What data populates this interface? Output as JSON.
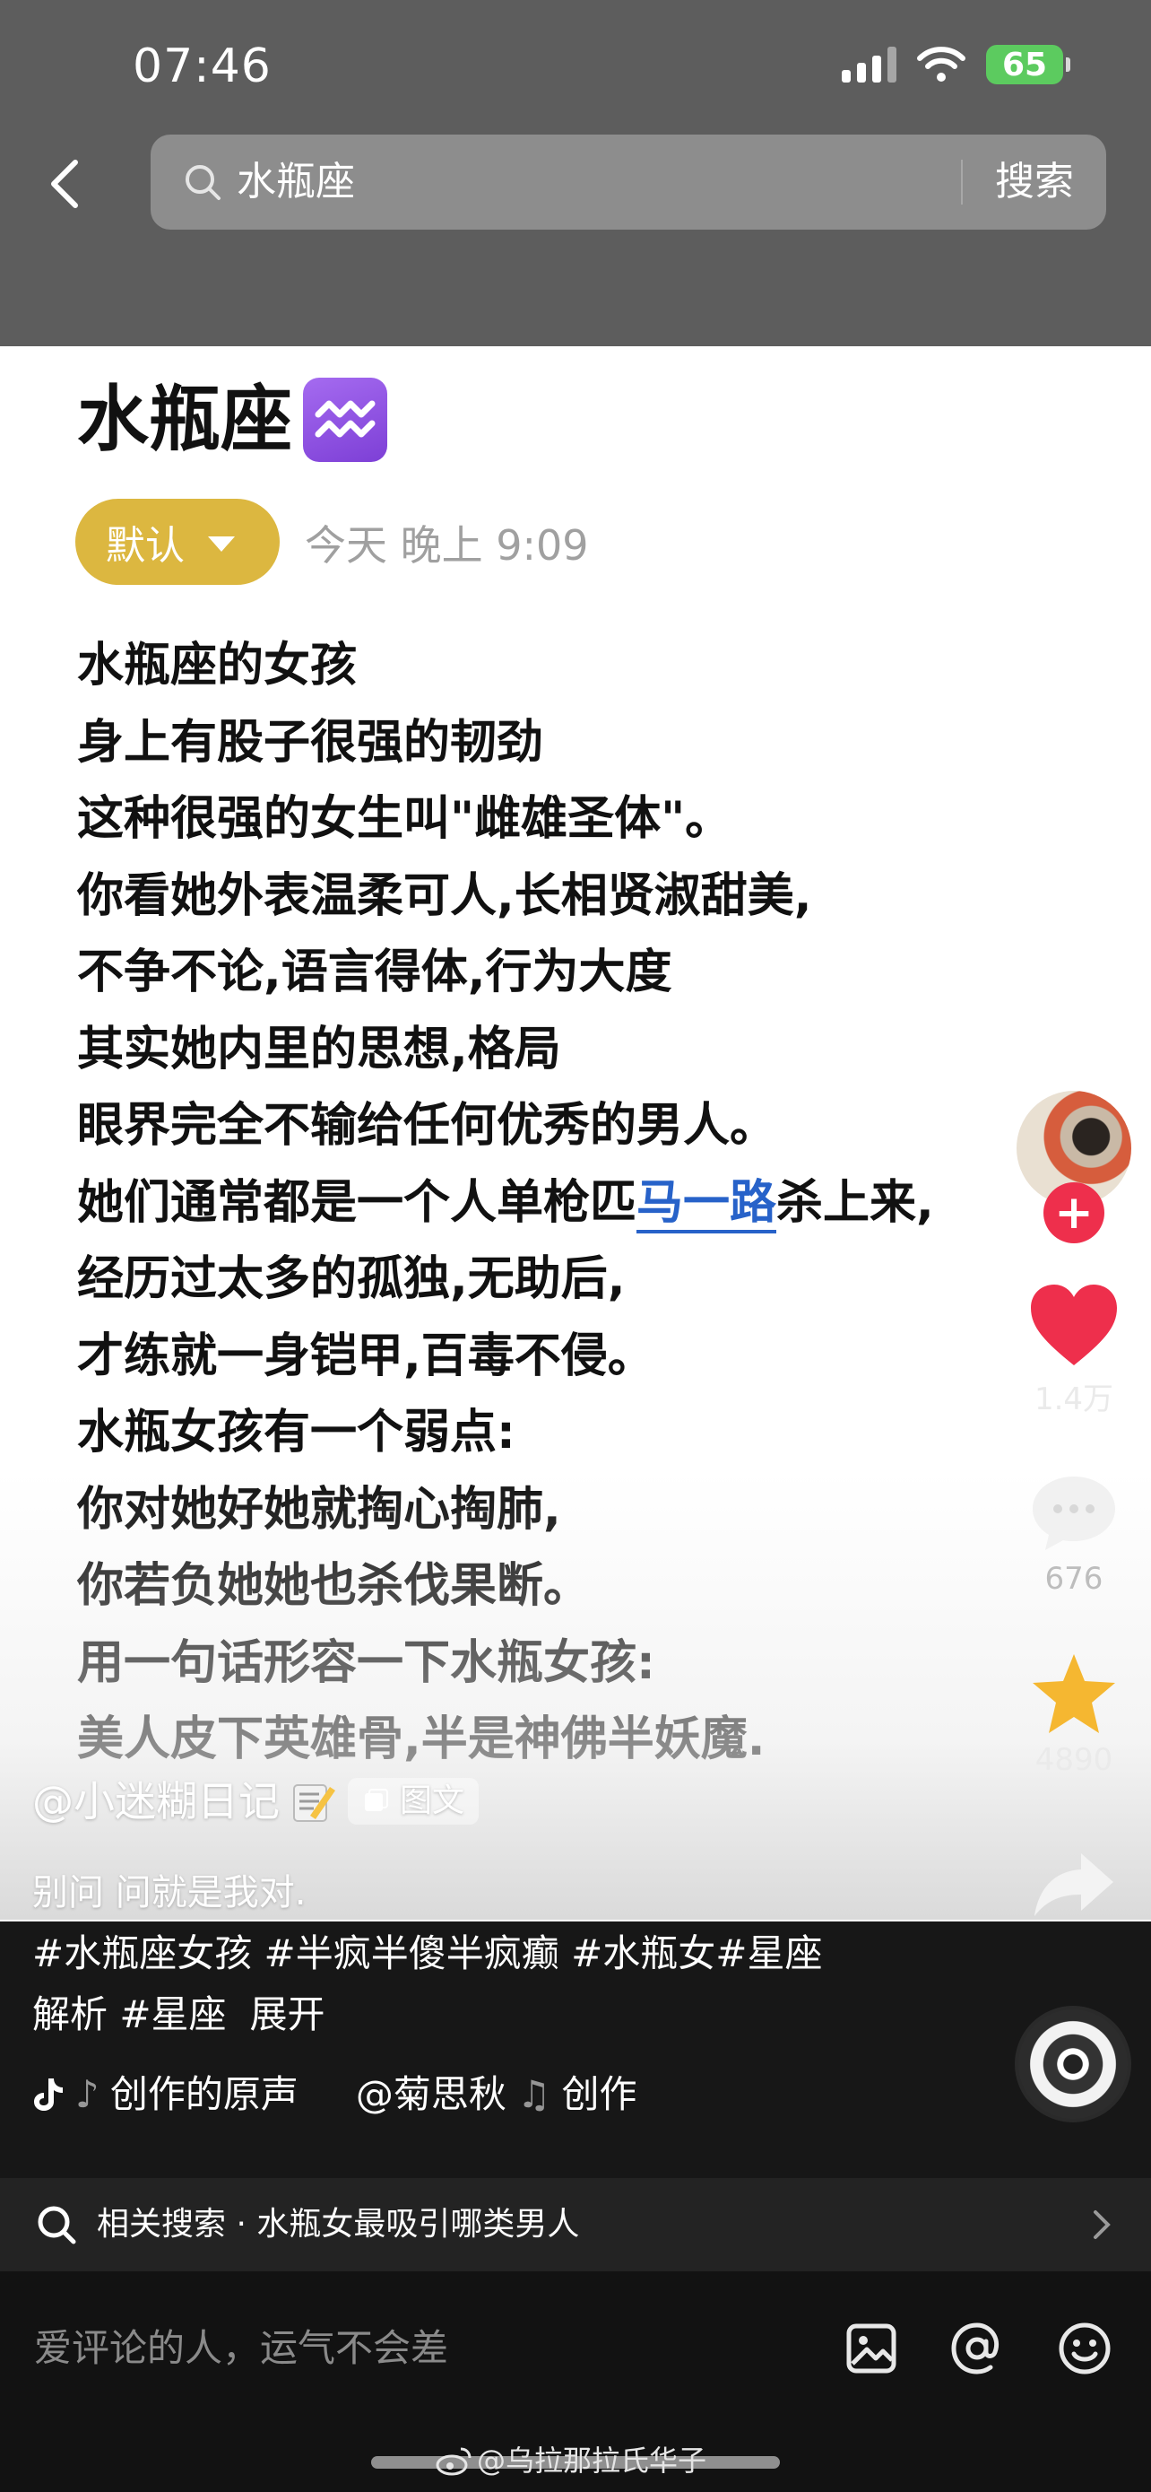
{
  "status": {
    "time": "07:46",
    "battery": "65"
  },
  "search": {
    "query": "水瓶座",
    "button_label": "搜索"
  },
  "note": {
    "title": "水瓶座",
    "sort_label": "默认",
    "date": "今天 晚上 9:09",
    "lines": [
      "水瓶座的女孩",
      "身上有股子很强的韧劲",
      "这种很强的女生叫\"雌雄圣体\"。",
      "你看她外表温柔可人,长相贤淑甜美,",
      "不争不论,语言得体,行为大度",
      "其实她内里的思想,格局",
      "眼界完全不输给任何优秀的男人。",
      "她们通常都是一个人单枪匹",
      "经历过太多的孤独,无助后,",
      "才练就一身铠甲,百毒不侵。",
      "水瓶女孩有一个弱点:",
      "你对她好她就掏心掏肺,",
      "你若负她她也杀伐果断。",
      "用一句话形容一下水瓶女孩:",
      "美人皮下英雄骨,半是神佛半妖魔."
    ],
    "line8_link": "马一路",
    "line8_tail": "杀上来,"
  },
  "post": {
    "author": "@小迷糊日记",
    "type_badge": "图文",
    "caption": "别问 问就是我对.",
    "hashtags_line1": "#水瓶座女孩 #半疯半傻半疯癫 #水瓶女#星座",
    "hashtags_line2": "解析 #星座",
    "expand_label": "展开",
    "music_title": "创作的原声",
    "music_author": "@菊思秋",
    "music_tail": "创作"
  },
  "actions": {
    "likes": "1.4万",
    "comments": "676",
    "favorites": "4890"
  },
  "related": {
    "label": "相关搜索",
    "separator": "·",
    "query": "水瓶女最吸引哪类男人"
  },
  "comment_bar": {
    "placeholder": "爱评论的人，运气不会差"
  },
  "watermark": "@乌拉那拉氏华子",
  "colors": {
    "accent_pill": "#dcb740",
    "link": "#2762c9",
    "like": "#ee2f4c",
    "favorite": "#f5b731"
  }
}
